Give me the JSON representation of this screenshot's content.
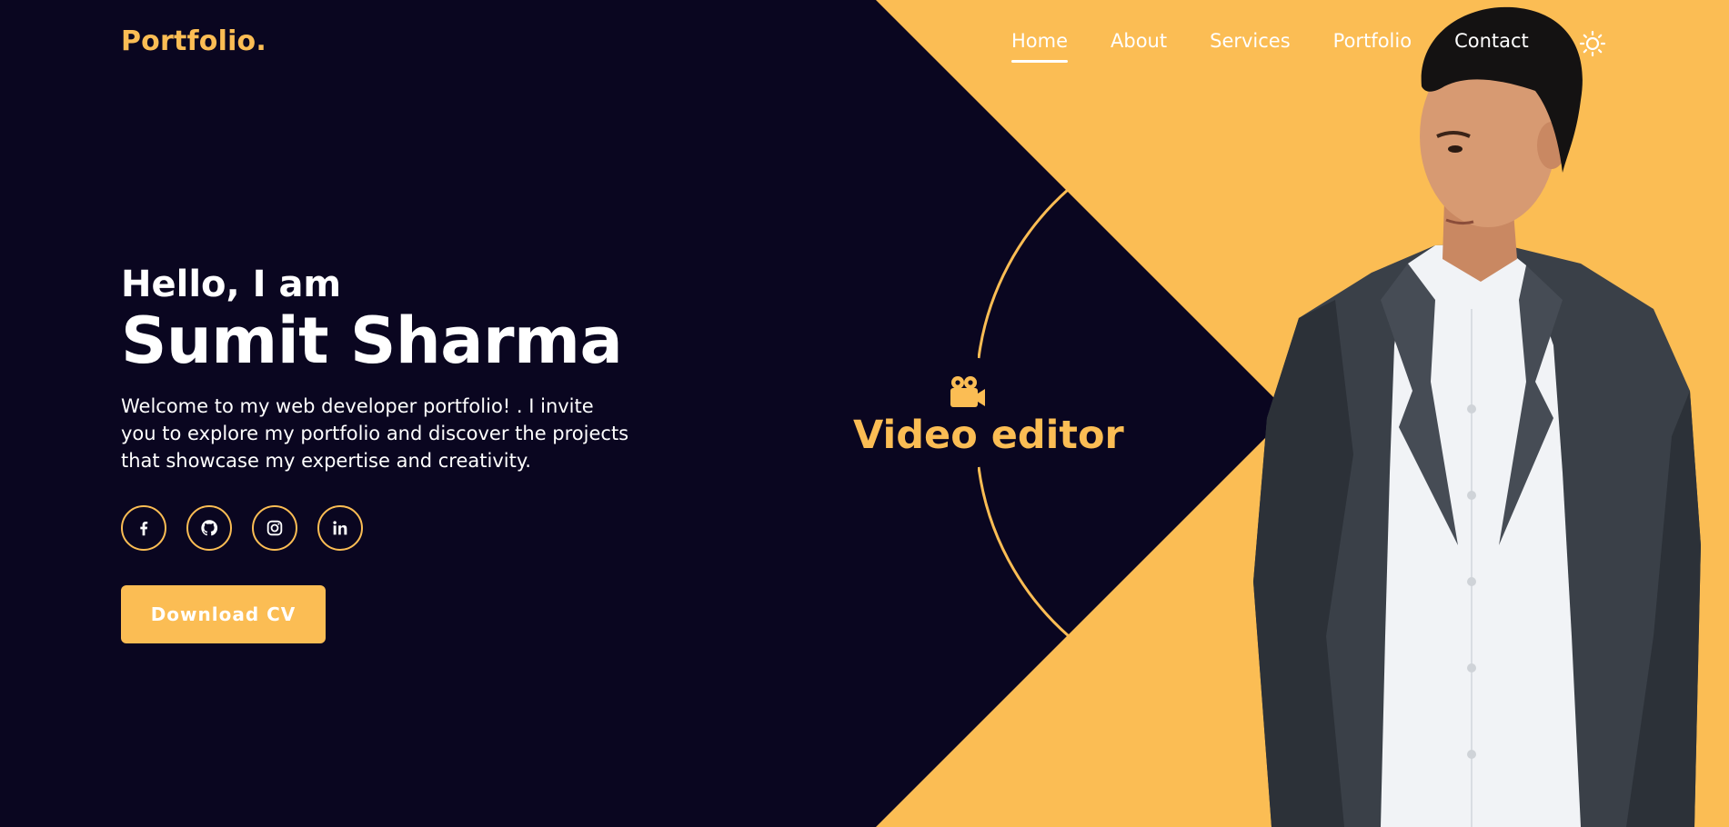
{
  "brand": {
    "logo": "Portfolio."
  },
  "nav": {
    "items": [
      {
        "label": "Home",
        "active": true
      },
      {
        "label": "About",
        "active": false
      },
      {
        "label": "Services",
        "active": false
      },
      {
        "label": "Portfolio",
        "active": false
      },
      {
        "label": "Contact",
        "active": false
      }
    ],
    "theme_icon": "sun-icon"
  },
  "hero": {
    "greeting": "Hello, I am",
    "name": "Sumit Sharma",
    "intro": "Welcome to my web developer portfolio! . I invite you to explore my portfolio and discover the projects that showcase my expertise and creativity.",
    "socials": [
      {
        "icon": "facebook-icon"
      },
      {
        "icon": "github-icon"
      },
      {
        "icon": "instagram-icon"
      },
      {
        "icon": "linkedin-icon"
      }
    ],
    "cta_label": "Download CV"
  },
  "role": {
    "icon": "video-camera-icon",
    "text": "Video editor"
  },
  "colors": {
    "background": "#0a0620",
    "accent": "#fbbd54",
    "text": "#ffffff"
  }
}
